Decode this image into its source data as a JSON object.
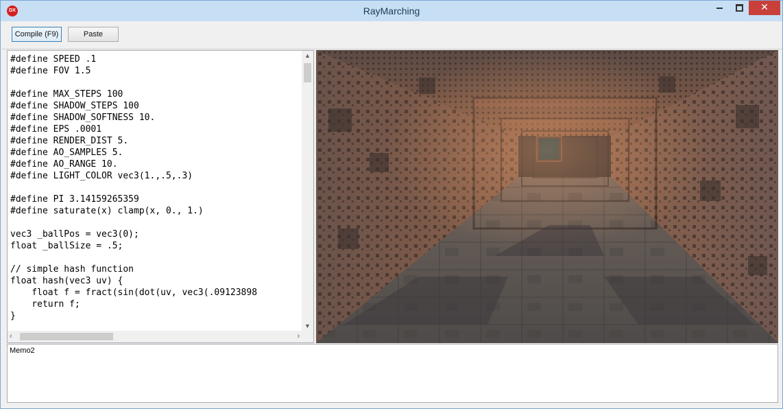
{
  "window": {
    "title": "RayMarching",
    "app_icon_text": "DX",
    "min_glyph": "",
    "close_glyph": "✕"
  },
  "toolbar": {
    "compile_label": "Compile (F9)",
    "paste_label": "Paste"
  },
  "editor": {
    "code": "#define SPEED .1\n#define FOV 1.5\n\n#define MAX_STEPS 100\n#define SHADOW_STEPS 100\n#define SHADOW_SOFTNESS 10.\n#define EPS .0001\n#define RENDER_DIST 5.\n#define AO_SAMPLES 5.\n#define AO_RANGE 10.\n#define LIGHT_COLOR vec3(1.,.5,.3)\n\n#define PI 3.14159265359\n#define saturate(x) clamp(x, 0., 1.)\n\nvec3 _ballPos = vec3(0);\nfloat _ballSize = .5;\n\n// simple hash function\nfloat hash(vec3 uv) {\n    float f = fract(sin(dot(uv, vec3(.09123898\n    return f;\n}",
    "scroll_up_glyph": "▲",
    "scroll_down_glyph": "▼",
    "scroll_left_glyph": "‹",
    "scroll_right_glyph": "›"
  },
  "memo": {
    "text": "Memo2"
  },
  "colors": {
    "titlebar": "#c7dff5",
    "close_button": "#c9403a",
    "accent_border": "#3c7fb1"
  }
}
